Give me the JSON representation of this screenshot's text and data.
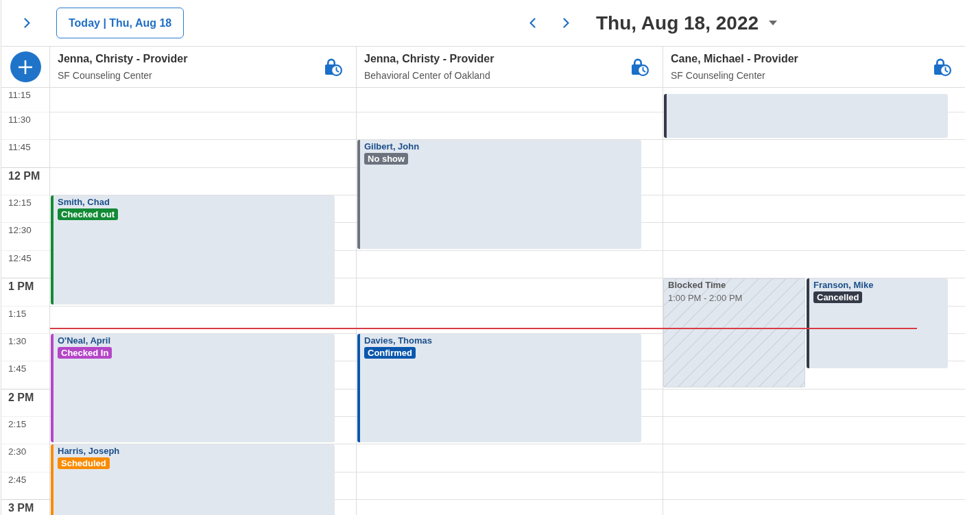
{
  "toolbar": {
    "today_button": "Today | Thu, Aug 18",
    "date_title": "Thu, Aug 18, 2022"
  },
  "columns": [
    {
      "provider": "Jenna, Christy - Provider",
      "location": "SF Counseling Center",
      "events": [
        {
          "kind": "appointment",
          "patient": "Smith, Chad",
          "status": "Checked out",
          "color": "#138a36"
        },
        {
          "kind": "appointment",
          "patient": "O'Neal, April",
          "status": "Checked In",
          "color": "#b546c8"
        },
        {
          "kind": "appointment",
          "patient": "Harris, Joseph",
          "status": "Scheduled",
          "color": "#f98b00"
        }
      ]
    },
    {
      "provider": "Jenna, Christy - Provider",
      "location": "Behavioral Center of Oakland",
      "events": [
        {
          "kind": "appointment",
          "patient": "Gilbert, John",
          "status": "No show",
          "color": "#6c737e"
        },
        {
          "kind": "appointment",
          "patient": "Davies, Thomas",
          "status": "Confirmed",
          "color": "#0b57ad"
        }
      ]
    },
    {
      "provider": "Cane, Michael - Provider",
      "location": "SF Counseling Center",
      "events": [
        {
          "kind": "appointment",
          "color": "#343a48"
        },
        {
          "kind": "blocked",
          "title": "Blocked Time",
          "time": "1:00 PM - 2:00 PM"
        },
        {
          "kind": "appointment",
          "patient": "Franson, Mike",
          "status": "Cancelled",
          "color": "#343a48"
        }
      ]
    }
  ],
  "time_slots": [
    {
      "label": "11:15",
      "kind": "quarter"
    },
    {
      "label": "11:30",
      "kind": "quarter"
    },
    {
      "label": "11:45",
      "kind": "quarter"
    },
    {
      "label": "12 PM",
      "kind": "hour"
    },
    {
      "label": "12:15",
      "kind": "quarter"
    },
    {
      "label": "12:30",
      "kind": "quarter"
    },
    {
      "label": "12:45",
      "kind": "quarter"
    },
    {
      "label": "1 PM",
      "kind": "hour"
    },
    {
      "label": "1:15",
      "kind": "quarter"
    },
    {
      "label": "1:30",
      "kind": "quarter"
    },
    {
      "label": "1:45",
      "kind": "quarter"
    },
    {
      "label": "2 PM",
      "kind": "hour"
    },
    {
      "label": "2:15",
      "kind": "quarter"
    },
    {
      "label": "2:30",
      "kind": "quarter"
    },
    {
      "label": "2:45",
      "kind": "quarter"
    },
    {
      "label": "3 PM",
      "kind": "hour"
    }
  ]
}
